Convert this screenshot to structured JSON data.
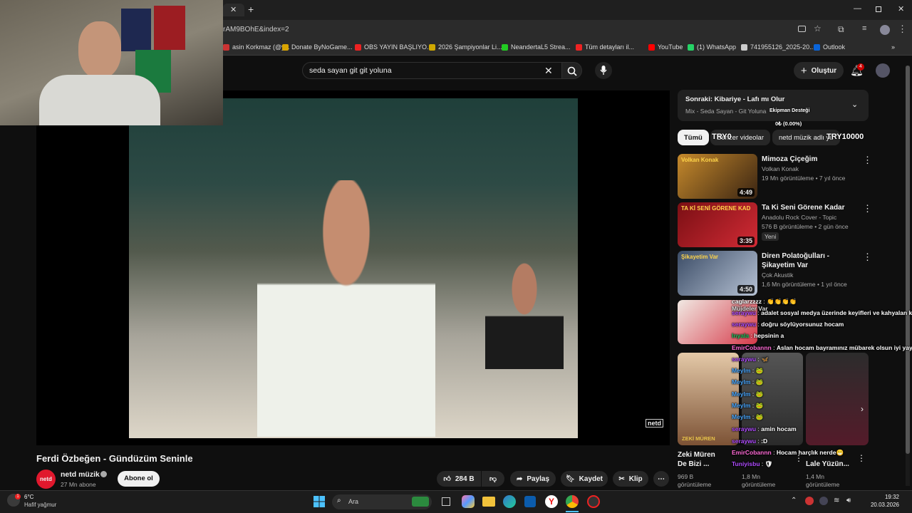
{
  "browser": {
    "url_fragment": "rAM9BOhE&index=2",
    "bookmarks": [
      {
        "label": "asin Korkmaz (@y...",
        "color": "#c33"
      },
      {
        "label": "Donate ByNoGame...",
        "color": "#d9a400"
      },
      {
        "label": "OBS YAYIN BAŞLIYO...",
        "color": "#e22"
      },
      {
        "label": "2026 Şampiyonlar Li...",
        "color": "#cfa800"
      },
      {
        "label": "NeandertaL5 Strea...",
        "color": "#2c2"
      },
      {
        "label": "Tüm detayları il...",
        "color": "#e22"
      },
      {
        "label": "YouTube",
        "color": "#f00"
      },
      {
        "label": "(1) WhatsApp",
        "color": "#25d366"
      },
      {
        "label": "741955126_2025-20...",
        "color": "#ccc"
      },
      {
        "label": "Outlook",
        "color": "#0a64d8"
      }
    ]
  },
  "header": {
    "search_value": "seda sayan git git yoluna",
    "create_label": "Oluştur",
    "notif_count": "4"
  },
  "video": {
    "title": "Ferdi Özbeğen - Gündüzüm Seninle",
    "channel": "netd müzik",
    "subs": "27 Mn abone",
    "subscribe": "Abone ol",
    "likes": "284 B",
    "share": "Paylaş",
    "save": "Kaydet",
    "clip": "Klip",
    "watermark": "netd"
  },
  "queue": {
    "next_label": "Sonraki: Kibariye - Lafı mı Olur",
    "mix_label": "Mix - Seda Sayan - Git Yoluna"
  },
  "overlay": {
    "goal_title": "Ekipman Desteği",
    "goal_value": "0₺ (0.00%)",
    "goal_min": "TRY0",
    "goal_max": "TRY10000"
  },
  "chips": [
    "Tümü",
    "Benzer videolar",
    "netd müzik adlı yü"
  ],
  "recs": [
    {
      "title": "Mimoza Çiçeğim",
      "channel": "Volkan Konak",
      "meta": "19 Mn görüntüleme • 7 yıl önce",
      "duration": "4:49",
      "badge": "",
      "thumb_text": "Volkan Konak"
    },
    {
      "title": "Ta Ki Seni Görene Kadar",
      "channel": "Anadolu Rock Cover - Topic",
      "meta": "576 B görüntüleme • 2 gün önce",
      "duration": "3:35",
      "badge": "Yeni",
      "thumb_text": "TA Kİ SENİ GÖRENE KAD"
    },
    {
      "title": "Diren Polatoğulları - Şikayetim Var",
      "channel": "Çok Akustik",
      "meta": "1,6 Mn görüntüleme • 1 yıl önce",
      "duration": "4:50",
      "badge": "",
      "thumb_text": "Şikayetim Var"
    }
  ],
  "shorts": [
    {
      "title": "Zeki Müren De Bizi ...",
      "views": "969 B",
      "unit": "görüntüleme",
      "label": "ZEKİ MÜREN"
    },
    {
      "title": "",
      "views": "1,8 Mn",
      "unit": "görüntüleme",
      "label": ""
    },
    {
      "title": "Lale Yüzün...",
      "views": "1,4 Mn",
      "unit": "görüntüleme",
      "label": ""
    }
  ],
  "chat": [
    {
      "user": "caglarzzzz",
      "msg": "👏👏👏👏",
      "color": "#fff"
    },
    {
      "user": "",
      "msg": "Müjdeler Var",
      "color": "#fff"
    },
    {
      "user": "seraywu",
      "msg": "adalet sosyal medya üzerinde keyifleri ve kahyalan kar",
      "color": "#b04cff"
    },
    {
      "user": "seraywu",
      "msg": "doğru söylüyorsunuz hocam",
      "color": "#b04cff"
    },
    {
      "user": "Inyala",
      "msg": "hepsinin a",
      "color": "#1ec45e"
    },
    {
      "user": "EmirCobannn",
      "msg": "Aslan hocam bayramınız mübarek olsun iyi yayın",
      "color": "#ff6ad5"
    },
    {
      "user": "seraywu",
      "msg": "🦋",
      "color": "#b04cff"
    },
    {
      "user": "Meylm",
      "msg": "🐸",
      "color": "#4aa8ff"
    },
    {
      "user": "Meylm",
      "msg": "🐸",
      "color": "#4aa8ff"
    },
    {
      "user": "Meylm",
      "msg": "🐸",
      "color": "#4aa8ff"
    },
    {
      "user": "Meylm",
      "msg": "🐸",
      "color": "#4aa8ff"
    },
    {
      "user": "Meylm",
      "msg": "🐸",
      "color": "#4aa8ff"
    },
    {
      "user": "seraywu",
      "msg": "amin hocam",
      "color": "#b04cff"
    },
    {
      "user": "seraywu",
      "msg": ":D",
      "color": "#b04cff"
    },
    {
      "user": "EmirCobannn",
      "msg": "Hocam harçlık nerde😁",
      "color": "#ff6ad5"
    },
    {
      "user": "Tuniyisbu",
      "msg": "🛡",
      "color": "#b04cff"
    }
  ],
  "taskbar": {
    "weather_temp": "6°C",
    "weather_desc": "Hafif yağmur",
    "search_placeholder": "Ara",
    "time": "19:32",
    "date": "20.03.2026"
  },
  "colors": {
    "accent": "#ff0000",
    "bg": "#0f0f0f",
    "chip": "#272727",
    "meta": "#aaaaaa"
  }
}
